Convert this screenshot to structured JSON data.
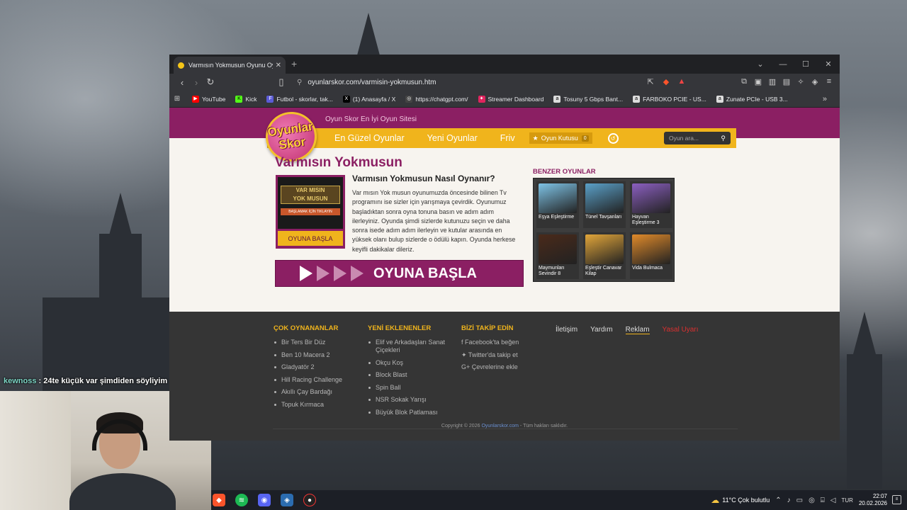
{
  "browser": {
    "tab_title": "Varmısın Yokmusun Oyunu Oyna",
    "url": "oyunlarskor.com/varmisin-yokmusun.htm",
    "bookmarks": [
      "YouTube",
      "Kick",
      "Futbol - skorlar, tak...",
      "(1) Anasayfa / X",
      "https://chatgpt.com/",
      "Streamer Dashboard",
      "Tosuny 5 Gbps Bant...",
      "FARBOKO PCIE - US...",
      "Zunate PCIe - USB 3..."
    ],
    "bookmark_colors": [
      "#ff0000",
      "#53fc18",
      "#5b5bd6",
      "#000000",
      "#444444",
      "#e0245e",
      "#777777",
      "#777777",
      "#777777"
    ]
  },
  "site": {
    "slogan": "Oyun Skor En İyi Oyun Sitesi",
    "logo_line1": "Oyunlar",
    "logo_line2": "Skor",
    "menu": [
      "En Güzel Oyunlar",
      "Yeni Oyunlar",
      "Friv"
    ],
    "game_box_label": "Oyun Kutusu",
    "game_box_count": "0",
    "search_placeholder": "Oyun ara..."
  },
  "game": {
    "title": "Varmısın Yokmusun",
    "thumb_line1": "VAR MISIN",
    "thumb_line2": "YOK MUSUN",
    "thumb_sub": "BAŞLAMAK İÇİN TIKLAYIN",
    "play_small": "OYUNA BAŞLA",
    "howto_title": "Varmısın Yokmusun Nasıl Oynanır?",
    "howto_text": "Var mısın Yok musun oyunumuzda öncesinde bilinen Tv programını ise sizler için yarışmaya çevirdik. Oyunumuz başladıktan sonra oyna tonuna basın ve adım adım ilerleyiniz. Oyunda şimdi sizlerde kutunuzu seçin ve daha sonra isede adım adım ilerleyin ve kutular arasında en yüksek olanı bulup sizlerde o ödülü kapın. Oyunda herkese keyifli dakikalar dileriz.",
    "play_big": "OYUNA BAŞLA"
  },
  "similar": {
    "title": "BENZER OYUNLAR",
    "items": [
      {
        "name": "Eşya Eşleştirme",
        "color": "#7ec3e6"
      },
      {
        "name": "Tünel Tavşanları",
        "color": "#5aa0c8"
      },
      {
        "name": "Hayvan Eşleştirme 3",
        "color": "#8b5fc0"
      },
      {
        "name": "Maymunları Sevindir 8",
        "color": "#4a2a1a"
      },
      {
        "name": "Eşleştir Canavar Kilap",
        "color": "#e2a63a"
      },
      {
        "name": "Vida Bulmaca",
        "color": "#e08a2a"
      }
    ]
  },
  "footer": {
    "col1_title": "ÇOK OYNANANLAR",
    "col1": [
      "Bir Ters Bir Düz",
      "Ben 10 Macera 2",
      "Gladyatör 2",
      "Hill Racing Challenge",
      "Akıllı Çay Bardağı",
      "Topuk Kırmaca"
    ],
    "col2_title": "YENİ EKLENENLER",
    "col2": [
      "Elif ve Arkadaşları Sanat Çiçekleri",
      "Okçu Koş",
      "Block Blast",
      "Spin Ball",
      "NSR Sokak Yarışı",
      "Büyük Blok Patlaması"
    ],
    "col3_title": "BİZİ TAKİP EDİN",
    "col3": [
      "Facebook'ta beğen",
      "Twitter'da takip et",
      "Çevrelerine ekle"
    ],
    "links": [
      "İletişim",
      "Yardım",
      "Reklam",
      "Yasal Uyarı"
    ],
    "copyright_pre": "Copyright © 2026 ",
    "copyright_site": "Oyunlarskor.com",
    "copyright_post": " - Tüm hakları saklıdır."
  },
  "stream": {
    "chat_user": "kewnoss",
    "chat_msg": " : 24te küçük var şimdiden söyliyim"
  },
  "taskbar": {
    "weather": "11°C  Çok bulutlu",
    "lang": "TUR",
    "time": "22:07",
    "date": "20.02.2026"
  }
}
